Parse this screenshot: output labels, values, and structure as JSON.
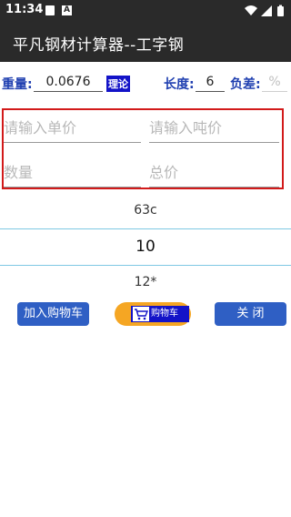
{
  "status_bar": {
    "time": "11:34",
    "notif_a": "A"
  },
  "app": {
    "title": "平凡钢材计算器--工字钢"
  },
  "summary": {
    "weight_label": "重量:",
    "weight_value": "0.0676",
    "theory_badge": "理论",
    "length_label": "长度:",
    "length_value": "6",
    "tolerance_label": "负差:",
    "tolerance_placeholder": "%"
  },
  "inputs": {
    "unit_price_placeholder": "请输入单价",
    "ton_price_placeholder": "请输入吨价",
    "quantity_placeholder": "数量",
    "total_placeholder": "总价"
  },
  "picker": {
    "items": [
      "63c",
      "10",
      "12*"
    ],
    "selected": "10"
  },
  "buttons": {
    "add_cart": "加入购物车",
    "cart": "购物车",
    "close": "关  闭"
  }
}
